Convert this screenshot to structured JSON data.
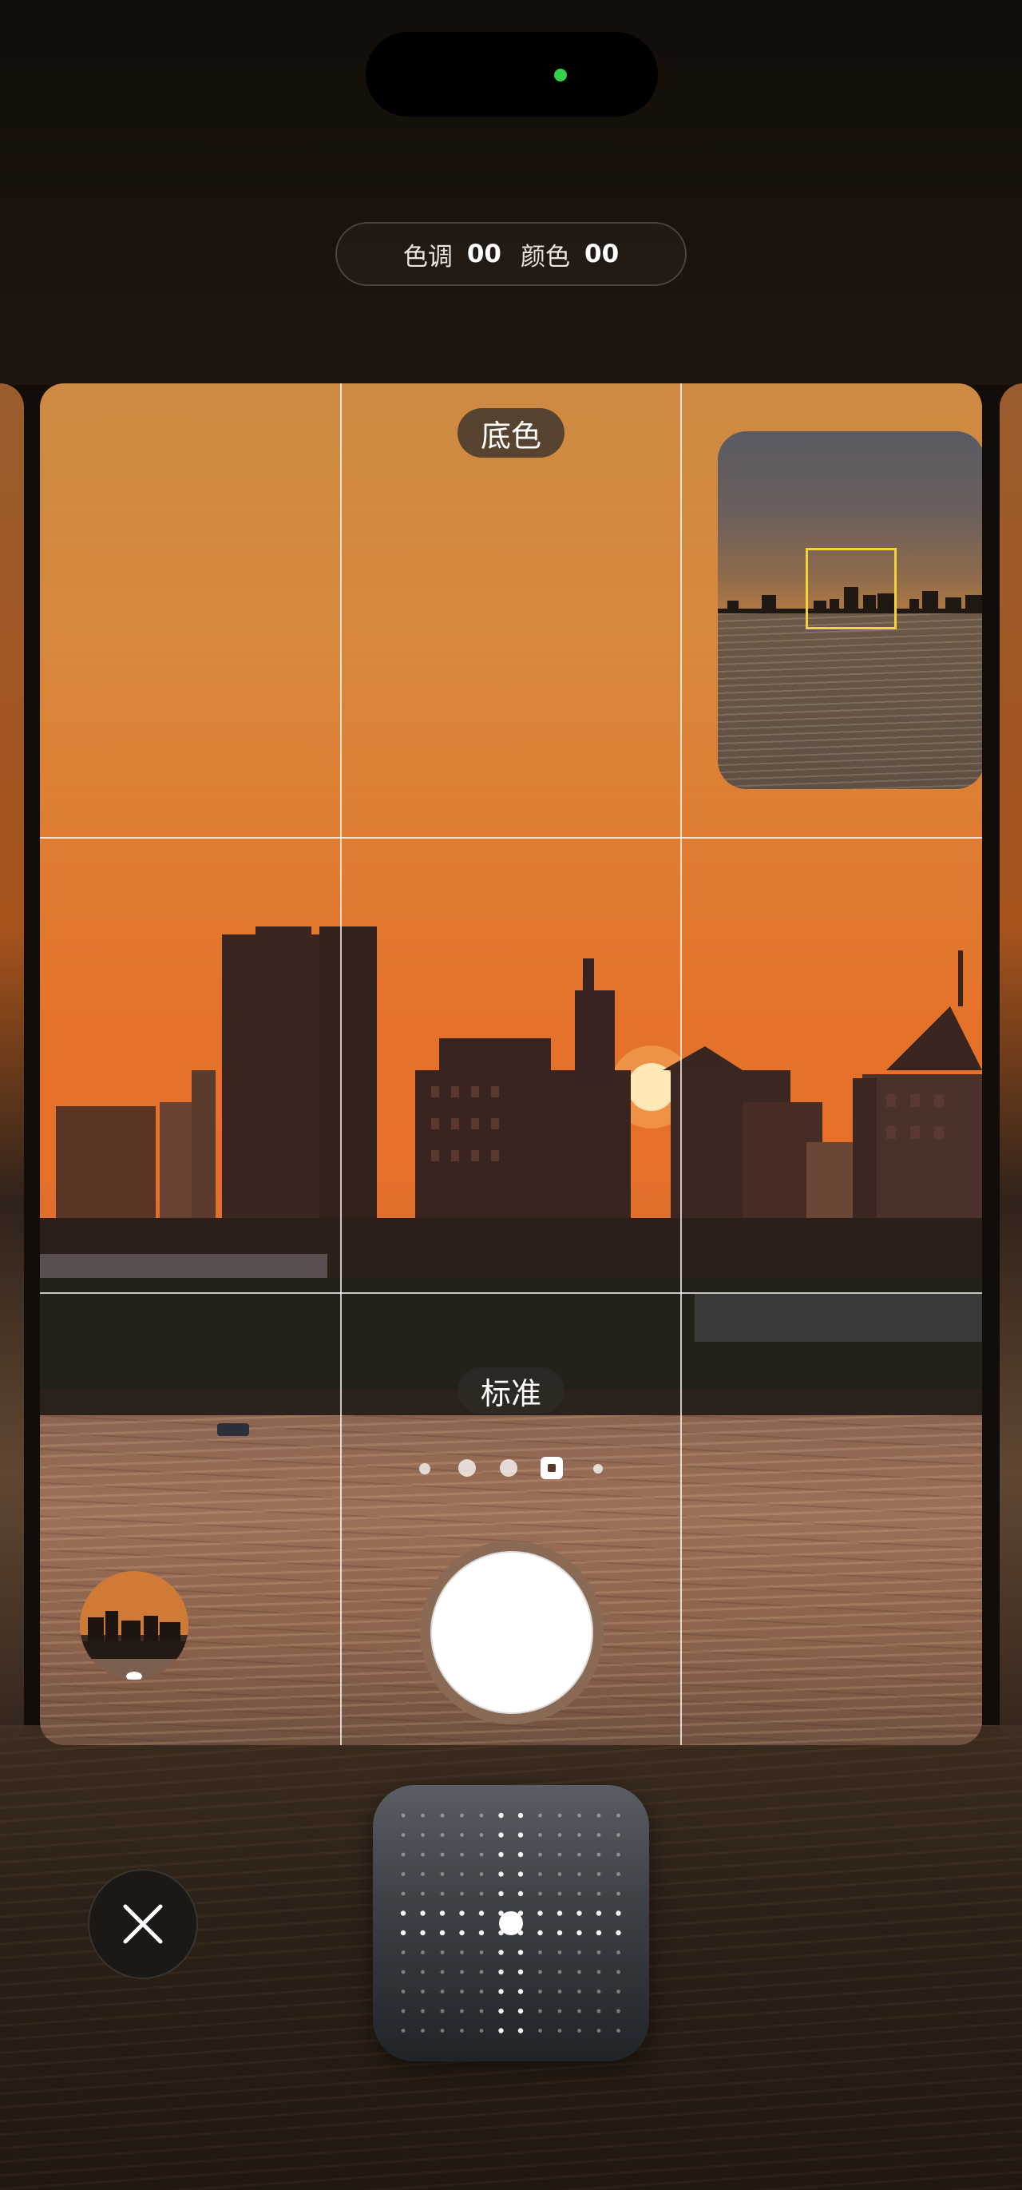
{
  "adjustment_bar": {
    "tone_label": "色调",
    "tone_value": "00",
    "color_label": "颜色",
    "color_value": "00"
  },
  "viewfinder": {
    "mode_label": "底色",
    "zoom_label": "标准",
    "zoom_levels_count": 5,
    "zoom_active_index": 3
  },
  "colors": {
    "focus_box": "#f4d23c",
    "status_dot": "#35d14a",
    "shutter_ring": "#8a6a55"
  },
  "icons": {
    "close": "close-icon",
    "pad": "tone-color-pad-icon"
  }
}
